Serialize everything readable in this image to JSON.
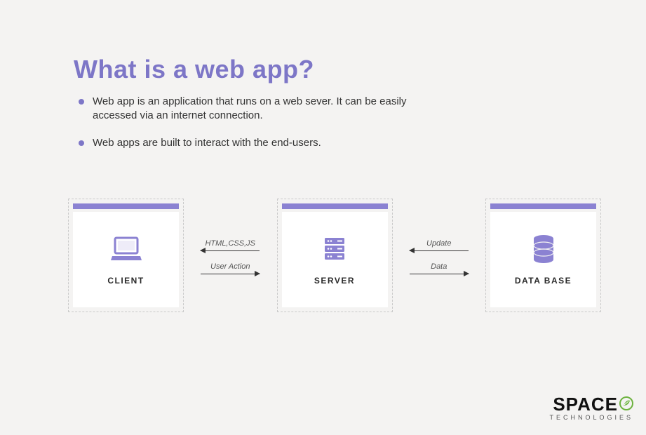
{
  "title": "What is a web app?",
  "bullets": [
    "Web app is an application that runs on a web sever. It can be easily accessed via an internet connection.",
    "Web apps are built to interact with the end-users."
  ],
  "diagram": {
    "nodes": {
      "client": {
        "label": "CLIENT",
        "icon": "laptop-icon"
      },
      "server": {
        "label": "SERVER",
        "icon": "server-icon"
      },
      "database": {
        "label": "DATA BASE",
        "icon": "database-icon"
      }
    },
    "connector_cs": {
      "top": {
        "label": "HTML,CSS,JS",
        "direction": "left"
      },
      "bottom": {
        "label": "User Action",
        "direction": "right"
      }
    },
    "connector_sd": {
      "top": {
        "label": "Update",
        "direction": "left"
      },
      "bottom": {
        "label": "Data",
        "direction": "right"
      }
    }
  },
  "brand": {
    "name": "SPACE",
    "sub": "TECHNOLOGIES"
  },
  "colors": {
    "accent": "#7d76c7",
    "bar": "#8b82d2",
    "leaf": "#6db23f"
  }
}
